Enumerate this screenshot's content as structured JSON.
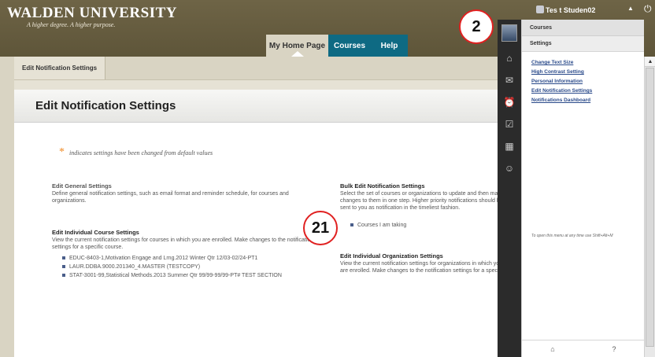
{
  "header": {
    "logo": "WALDEN UNIVERSITY",
    "tagline": "A higher degree. A higher purpose.",
    "tabs": [
      {
        "label": "My Home Page"
      },
      {
        "label": "Courses"
      },
      {
        "label": "Help"
      }
    ],
    "user_name": "Tes t Studen02"
  },
  "breadcrumb": {
    "label": "Edit Notification Settings"
  },
  "page": {
    "title": "Edit Notification Settings",
    "legend": "indicates settings have been changed from default values",
    "general": {
      "title": "Edit General Settings",
      "desc": "Define general notification settings, such as email format and reminder schedule, for courses and organizations."
    },
    "individual_course": {
      "title": "Edit Individual Course Settings",
      "desc": "View the current notification settings for courses in which you are enrolled. Make changes to the notification settings for a specific course.",
      "courses": [
        "EDUC-8403-1,Motivation Engage and Lrng.2012 Winter Qtr 12/03-02/24-PT1",
        "LAUR.DDBA.9000.201340_4.MASTER (TESTCOPY)",
        "STAT-3001-99,Statistical Methods.2013 Summer Qtr 99/99-99/99-PT# TEST SECTION"
      ]
    },
    "bulk": {
      "title": "Bulk Edit Notification Settings",
      "desc": "Select the set of courses or organizations to update and then make changes to them in one step. Higher priority notifications should be sent to you as notification in the timeliest fashion.",
      "items": [
        "Courses I am taking"
      ]
    },
    "individual_org": {
      "title": "Edit Individual Organization Settings",
      "desc": "View the current notification settings for organizations in which you are enrolled. Make changes to the notification settings for a specific organization."
    }
  },
  "side_menu": {
    "heading": "Courses",
    "subheading": "Settings",
    "links": [
      "Change Text Size",
      "High Contrast Setting",
      "Personal Information",
      "Edit Notification Settings",
      "Notifications Dashboard"
    ],
    "hint": "To open this menu at any time use Shift+Alt+M"
  },
  "callouts": [
    "2",
    "21"
  ]
}
